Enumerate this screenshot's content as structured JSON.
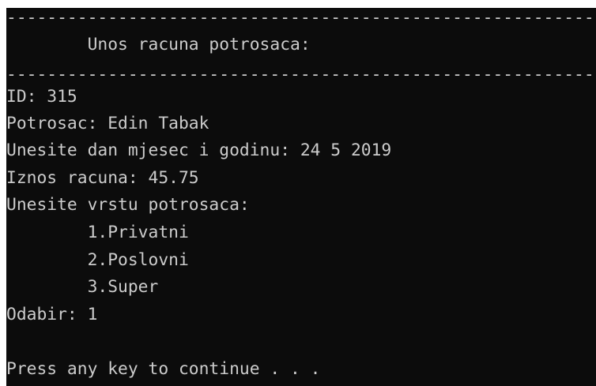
{
  "console": {
    "lines": [
      "----------------------------------------------------------------------",
      "        Unos racuna potrosaca:",
      "----------------------------------------------------------------------",
      "ID: 315",
      "Potrosac: Edin Tabak",
      "Unesite dan mjesec i godinu: 24 5 2019",
      "Iznos racuna: 45.75",
      "Unesite vrstu potrosaca:",
      "        1.Privatni",
      "        2.Poslovni",
      "        3.Super",
      "Odabir: 1",
      "Press any key to continue . . ."
    ]
  },
  "colors": {
    "background": "#0c0c0c",
    "text": "#cccccc",
    "frame": "#ffffff"
  }
}
